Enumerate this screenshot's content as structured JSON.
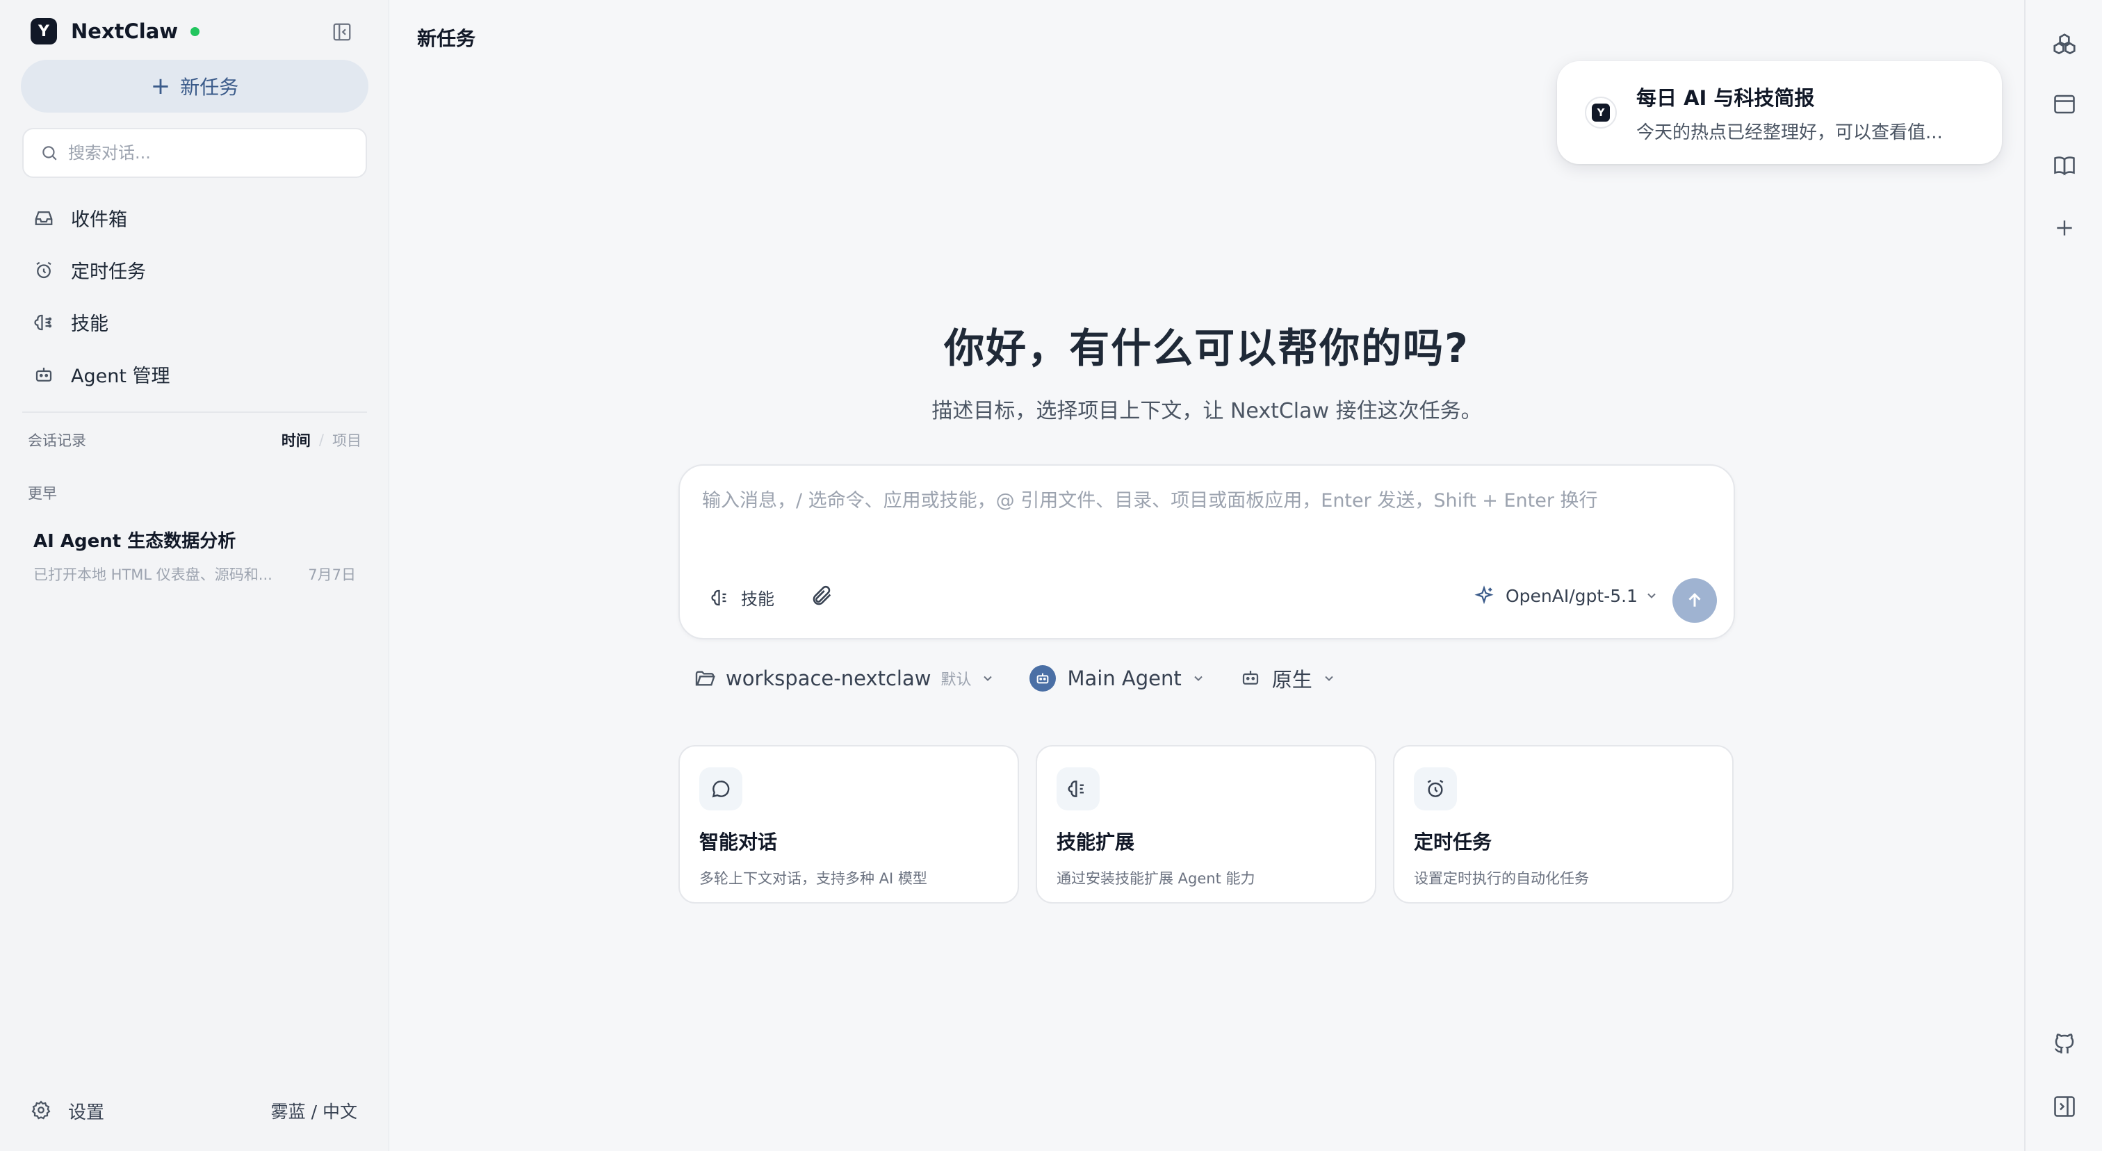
{
  "app": {
    "name": "NextClaw",
    "status_color": "#22c55e",
    "logo_glyph": "Y"
  },
  "sidebar": {
    "new_task_label": "新任务",
    "search_placeholder": "搜索对话...",
    "nav": [
      {
        "label": "收件箱",
        "icon": "inbox-icon"
      },
      {
        "label": "定时任务",
        "icon": "alarm-clock-icon"
      },
      {
        "label": "技能",
        "icon": "brain-icon"
      },
      {
        "label": "Agent 管理",
        "icon": "bot-icon"
      }
    ],
    "history_label": "会话记录",
    "sort": {
      "active": "时间",
      "separator": "/",
      "inactive": "项目"
    },
    "group_label": "更早",
    "conversations": [
      {
        "title": "AI Agent 生态数据分析",
        "preview": "已打开本地 HTML 仪表盘、源码和...",
        "date": "7月7日"
      }
    ],
    "settings_label": "设置",
    "theme_lang": "雾蓝 / 中文"
  },
  "main": {
    "page_title": "新任务",
    "notification": {
      "title": "每日 AI 与科技简报",
      "text": "今天的热点已经整理好，可以查看值...",
      "logo_glyph": "Y"
    },
    "hero_title": "你好，有什么可以帮你的吗?",
    "hero_subtitle": "描述目标，选择项目上下文，让 NextClaw 接住这次任务。",
    "composer": {
      "placeholder": "输入消息，/ 选命令、应用或技能，@ 引用文件、目录、项目或面板应用，Enter 发送，Shift + Enter 换行",
      "value": "",
      "skill_label": "技能",
      "model": "OpenAI/gpt-5.1"
    },
    "context": {
      "workspace": "workspace-nextclaw",
      "workspace_tag": "默认",
      "agent": "Main Agent",
      "mode": "原生"
    },
    "cards": [
      {
        "title": "智能对话",
        "desc": "多轮上下文对话，支持多种 AI 模型",
        "icon": "chat-bubble-icon"
      },
      {
        "title": "技能扩展",
        "desc": "通过安装技能扩展 Agent 能力",
        "icon": "brain-icon"
      },
      {
        "title": "定时任务",
        "desc": "设置定时执行的自动化任务",
        "icon": "alarm-clock-icon"
      }
    ]
  },
  "rail": {
    "icons": [
      "apps-icon",
      "browser-window-icon",
      "book-icon",
      "plus-icon",
      "github-icon",
      "panel-toggle-icon"
    ]
  },
  "colors": {
    "accent": "#3b5b8a",
    "send_button": "#9fb3d1",
    "agent_avatar": "#4a6fa5",
    "sidebar_bg": "#f3f4f6",
    "new_task_bg": "#e2e8f0"
  }
}
